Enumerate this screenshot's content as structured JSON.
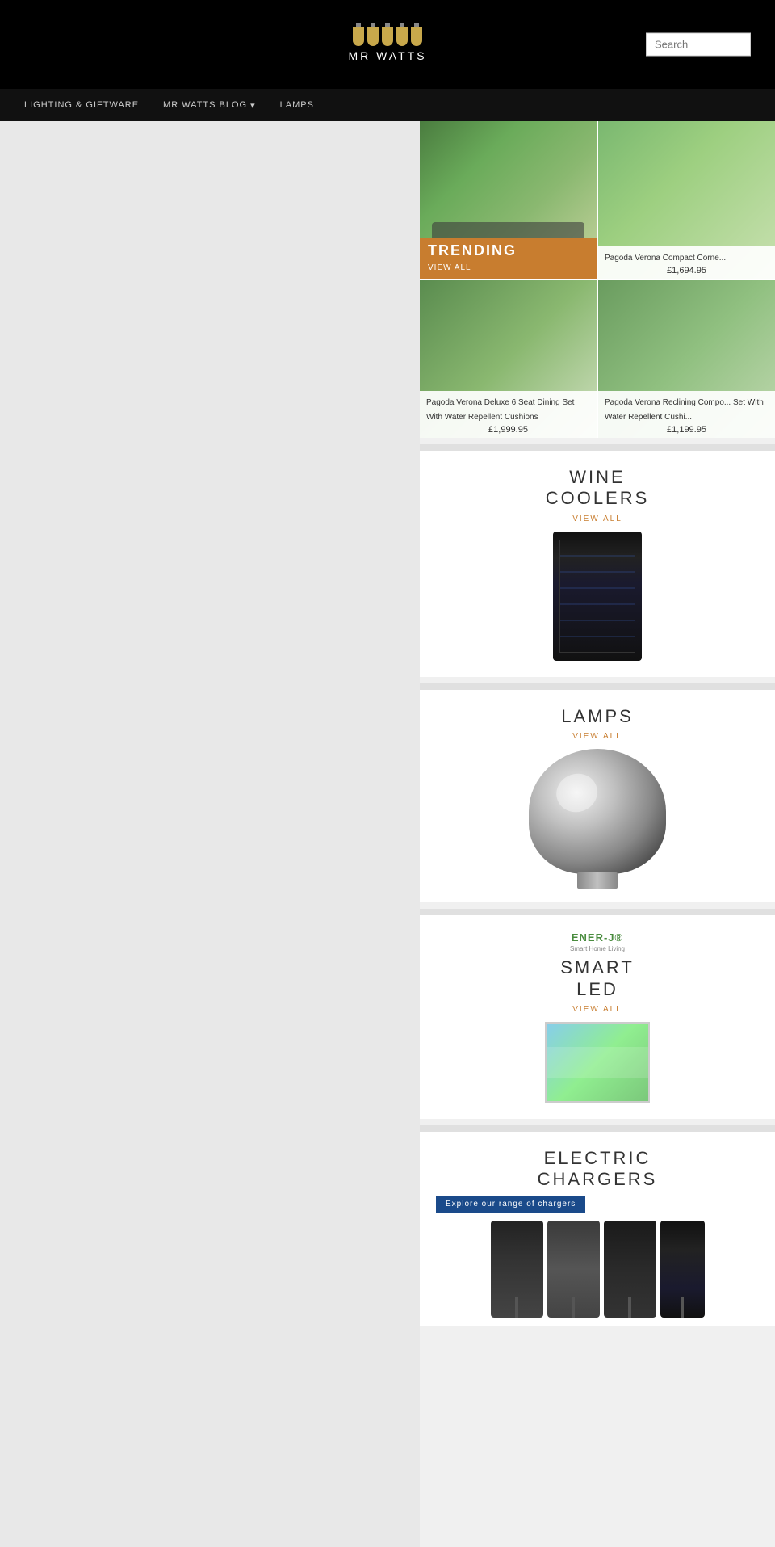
{
  "header": {
    "logo_text": "MR WATTS",
    "search_placeholder": "Search"
  },
  "nav": {
    "items": [
      {
        "label": "LIGHTING & GIFTWARE",
        "has_dropdown": false
      },
      {
        "label": "MR WATTS BLOG",
        "has_dropdown": true
      },
      {
        "label": "LAMPS",
        "has_dropdown": false
      }
    ]
  },
  "trending": {
    "badge_label": "TRENDING",
    "view_all": "VIEW ALL",
    "products": [
      {
        "name": "Pagoda Verona Compact Corne...",
        "price": "£1,694.95"
      },
      {
        "name": "Pagoda Verona Deluxe 6 Seat Dining Set With Water Repellent Cushions",
        "price": "£1,999.95"
      },
      {
        "name": "Pagoda Verona Reclining Compo... Set With Water Repellent Cushi...",
        "price": "£1,199.95"
      }
    ]
  },
  "wine_coolers": {
    "title_line1": "WINE",
    "title_line2": "COOLERS",
    "view_all": "VIEW ALL"
  },
  "lamps": {
    "title": "LAMPS",
    "view_all": "VIEW ALL"
  },
  "smart_led": {
    "title_line1": "SMART",
    "title_line2": "LED",
    "view_all": "VIEW ALL",
    "brand": "ENER-J®",
    "brand_sub": "Smart Home Living"
  },
  "electric_chargers": {
    "title_line1": "ELECTRIC",
    "title_line2": "CHARGERS",
    "explore_label": "Explore our range of chargers"
  }
}
